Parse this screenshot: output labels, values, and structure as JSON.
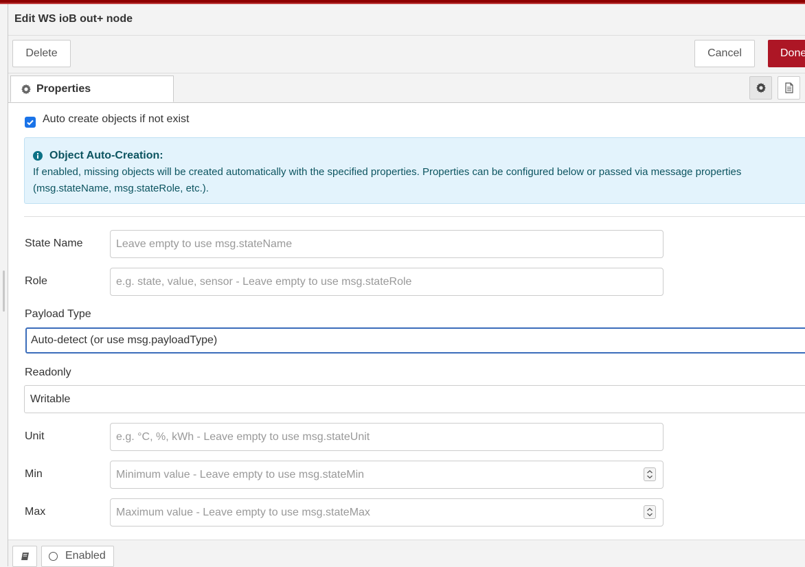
{
  "dialog": {
    "title": "Edit WS ioB out+ node"
  },
  "toolbar": {
    "delete_label": "Delete",
    "cancel_label": "Cancel",
    "done_label": "Done"
  },
  "tabs": {
    "properties_label": "Properties"
  },
  "form": {
    "auto_create": {
      "label": "Auto create objects if not exist",
      "checked": true
    },
    "info": {
      "title": "Object Auto-Creation:",
      "text": "If enabled, missing objects will be created automatically with the specified properties. Properties can be configured below or passed via message properties (msg.stateName, msg.stateRole, etc.)."
    },
    "state_name": {
      "label": "State Name",
      "value": "",
      "placeholder": "Leave empty to use msg.stateName"
    },
    "role": {
      "label": "Role",
      "value": "",
      "placeholder": "e.g. state, value, sensor - Leave empty to use msg.stateRole"
    },
    "payload_type": {
      "label": "Payload Type",
      "selected": "Auto-detect (or use msg.payloadType)"
    },
    "readonly": {
      "label": "Readonly",
      "selected": "Writable"
    },
    "unit": {
      "label": "Unit",
      "value": "",
      "placeholder": "e.g. °C, %, kWh - Leave empty to use msg.stateUnit"
    },
    "min": {
      "label": "Min",
      "value": "",
      "placeholder": "Minimum value - Leave empty to use msg.stateMin"
    },
    "max": {
      "label": "Max",
      "value": "",
      "placeholder": "Maximum value - Leave empty to use msg.stateMax"
    }
  },
  "footer": {
    "enabled_label": "Enabled"
  },
  "colors": {
    "done_button": "#ad1625",
    "checkbox": "#1a73e8",
    "info_bg": "#e3f3fc",
    "focus_border": "#3a6cba",
    "top_accent": "#8f0000"
  },
  "icons": [
    "gear-icon",
    "document-icon",
    "info-icon",
    "check-icon",
    "chevron-down-icon",
    "spinner-icon",
    "book-icon",
    "radio-icon"
  ]
}
